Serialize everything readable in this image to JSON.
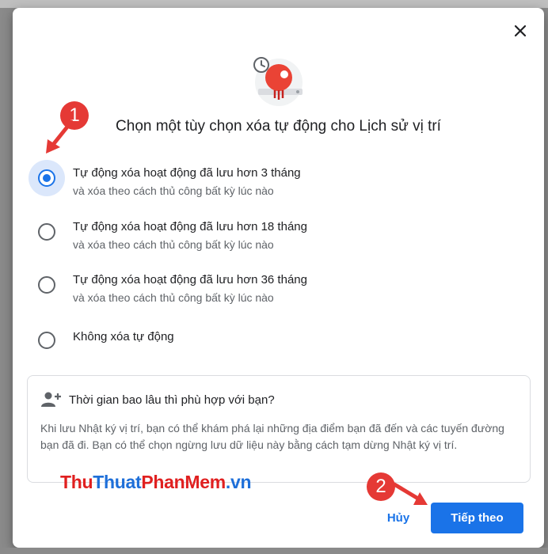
{
  "dialog": {
    "title": "Chọn một tùy chọn xóa tự động cho Lịch sử vị trí",
    "close_icon": "close-icon",
    "illustration_icon": "location-history-autodelete-illustration"
  },
  "options": [
    {
      "label": "Tự động xóa hoạt động đã lưu hơn 3 tháng",
      "sublabel": "và xóa theo cách thủ công bất kỳ lúc nào",
      "selected": true
    },
    {
      "label": "Tự động xóa hoạt động đã lưu hơn 18 tháng",
      "sublabel": "và xóa theo cách thủ công bất kỳ lúc nào",
      "selected": false
    },
    {
      "label": "Tự động xóa hoạt động đã lưu hơn 36 tháng",
      "sublabel": "và xóa theo cách thủ công bất kỳ lúc nào",
      "selected": false
    },
    {
      "label": "Không xóa tự động",
      "sublabel": "",
      "selected": false
    }
  ],
  "info": {
    "icon": "people-add-icon",
    "title": "Thời gian bao lâu thì phù hợp với bạn?",
    "body": "Khi lưu Nhật ký vị trí, bạn có thể khám phá lại những địa điểm bạn đã đến và các tuyến đường bạn đã đi. Bạn có thể chọn ngừng lưu dữ liệu này bằng cách tạm dừng Nhật ký vị trí."
  },
  "buttons": {
    "cancel": "Hủy",
    "next": "Tiếp theo"
  },
  "annotations": {
    "step1": "1",
    "step2": "2"
  },
  "watermark": {
    "part1": "Thu",
    "part2": "Thuat",
    "part3": "PhanMem",
    "part4": ".vn"
  },
  "colors": {
    "accent": "#1a73e8",
    "annotation": "#e53935",
    "selected_halo": "#dbe7fb"
  }
}
